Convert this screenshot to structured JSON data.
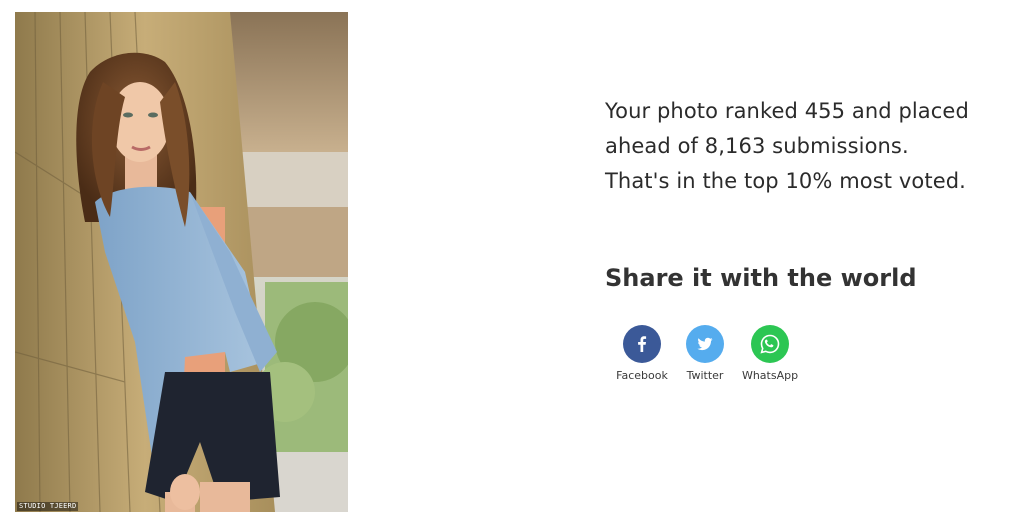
{
  "photo": {
    "credit": "STUDIO TJEERD"
  },
  "result": {
    "line1": "Your photo ranked 455 and placed",
    "line2": "ahead of 8,163 submissions.",
    "line3": "That's in the top 10% most voted."
  },
  "share": {
    "heading": "Share it with the world",
    "buttons": [
      {
        "label": "Facebook",
        "icon": "facebook-icon",
        "color": "#3b5998"
      },
      {
        "label": "Twitter",
        "icon": "twitter-icon",
        "color": "#55acee"
      },
      {
        "label": "WhatsApp",
        "icon": "whatsapp-icon",
        "color": "#2cc653"
      }
    ]
  }
}
